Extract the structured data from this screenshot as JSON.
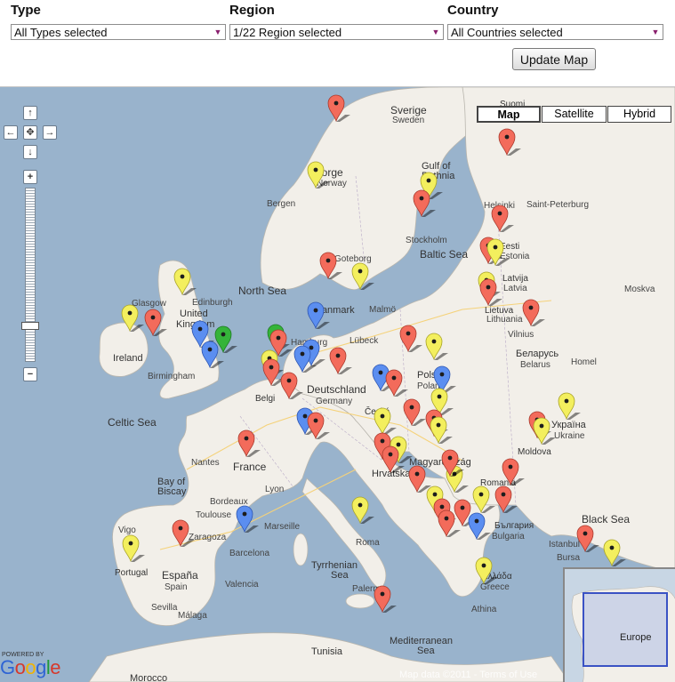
{
  "filters": {
    "type_label": "Type",
    "type_value": "All Types selected",
    "region_label": "Region",
    "region_value": "1/22 Region selected",
    "country_label": "Country",
    "country_value": "All Countries selected",
    "update_label": "Update Map"
  },
  "map": {
    "types": [
      "Map",
      "Satellite",
      "Hybrid"
    ],
    "selected_type": "Map",
    "attribution_data": "Map data ©2011",
    "attribution_sep": " - ",
    "attribution_terms": "Terms of Use",
    "powered_by": "POWERED BY",
    "overview_label": "Europe",
    "zoom_in": "+",
    "zoom_out": "−"
  },
  "colors": {
    "red": "#f36b5b",
    "yellow": "#f3ef5e",
    "blue": "#5b8ef0",
    "green": "#35b43a",
    "water": "#99b3cc",
    "land": "#f2efe9"
  },
  "labels": [
    [
      "Sverige",
      439,
      30,
      12,
      "#333"
    ],
    [
      "Sweden",
      441,
      40,
      10,
      "#444"
    ],
    [
      "Suomi",
      562,
      22,
      10,
      "#333"
    ],
    [
      "Norge",
      353,
      100,
      12,
      "#333"
    ],
    [
      "Norway",
      356,
      111,
      10,
      "#444"
    ],
    [
      "Bergen",
      300,
      134,
      10,
      "#444"
    ],
    [
      "Gulf of",
      474,
      92,
      11,
      "#333"
    ],
    [
      "Bothnia",
      474,
      103,
      11,
      "#333"
    ],
    [
      "Helsinki",
      544,
      136,
      10,
      "#444"
    ],
    [
      "Saint-Peterburg",
      592,
      135,
      10,
      "#444"
    ],
    [
      "Stockholm",
      456,
      175,
      10,
      "#444"
    ],
    [
      "Eesti",
      562,
      182,
      10,
      "#333"
    ],
    [
      "Estonia",
      562,
      193,
      10,
      "#444"
    ],
    [
      "Baltic Sea",
      472,
      192,
      12,
      "#333"
    ],
    [
      "Goteborg",
      376,
      196,
      10,
      "#444"
    ],
    [
      "Latvija",
      565,
      218,
      10,
      "#333"
    ],
    [
      "Latvia",
      566,
      229,
      10,
      "#444"
    ],
    [
      "North Sea",
      268,
      233,
      12,
      "#333"
    ],
    [
      "Danmark",
      354,
      254,
      11,
      "#333"
    ],
    [
      "Malmö",
      415,
      253,
      10,
      "#444"
    ],
    [
      "Lietuva",
      545,
      254,
      10,
      "#333"
    ],
    [
      "Lithuania",
      547,
      264,
      10,
      "#444"
    ],
    [
      "Moskva",
      702,
      230,
      10,
      "#444"
    ],
    [
      "Glasgow",
      148,
      246,
      10,
      "#444"
    ],
    [
      "Edinburgh",
      216,
      245,
      10,
      "#444"
    ],
    [
      "United",
      202,
      258,
      11,
      "#333"
    ],
    [
      "Kingdom",
      198,
      270,
      11,
      "#333"
    ],
    [
      "Ireland",
      127,
      308,
      11,
      "#333"
    ],
    [
      "Birmingham",
      166,
      328,
      10,
      "#444"
    ],
    [
      "Hamburg",
      327,
      290,
      10,
      "#444"
    ],
    [
      "Lübeck",
      393,
      288,
      10,
      "#444"
    ],
    [
      "Vilnius",
      571,
      281,
      10,
      "#444"
    ],
    [
      "Беларусь",
      580,
      303,
      11,
      "#333"
    ],
    [
      "Belarus",
      585,
      315,
      10,
      "#444"
    ],
    [
      "Homel",
      642,
      312,
      10,
      "#444"
    ],
    [
      "Polska",
      469,
      327,
      11,
      "#333"
    ],
    [
      "Poland",
      469,
      339,
      10,
      "#444"
    ],
    [
      "Deutschland",
      345,
      344,
      12,
      "#333"
    ],
    [
      "Germany",
      355,
      356,
      10,
      "#444"
    ],
    [
      "Belgi",
      287,
      353,
      10,
      "#333"
    ],
    [
      "Česká",
      410,
      368,
      10,
      "#333"
    ],
    [
      "Celtic Sea",
      121,
      381,
      12,
      "#333"
    ],
    [
      "Україна",
      620,
      383,
      11,
      "#333"
    ],
    [
      "Ukraine",
      623,
      395,
      10,
      "#444"
    ],
    [
      "France",
      262,
      431,
      12,
      "#333"
    ],
    [
      "Moldova",
      582,
      413,
      10,
      "#333"
    ],
    [
      "Magyarország",
      460,
      425,
      11,
      "#333"
    ],
    [
      "Nantes",
      215,
      425,
      10,
      "#444"
    ],
    [
      "Bay of",
      177,
      447,
      11,
      "#333"
    ],
    [
      "Biscay",
      177,
      458,
      11,
      "#333"
    ],
    [
      "Lyon",
      298,
      455,
      10,
      "#444"
    ],
    [
      "Hrvatska",
      418,
      438,
      11,
      "#333"
    ],
    [
      "Romania",
      540,
      448,
      10,
      "#333"
    ],
    [
      "Bordeaux",
      236,
      469,
      10,
      "#444"
    ],
    [
      "Toulouse",
      220,
      484,
      10,
      "#444"
    ],
    [
      "Marseille",
      297,
      497,
      10,
      "#444"
    ],
    [
      "Black Sea",
      654,
      490,
      12,
      "#333"
    ],
    [
      "България",
      556,
      496,
      10,
      "#333"
    ],
    [
      "Bulgaria",
      553,
      508,
      10,
      "#444"
    ],
    [
      "Zaragoza",
      212,
      509,
      10,
      "#444"
    ],
    [
      "Barcelona",
      258,
      527,
      10,
      "#444"
    ],
    [
      "Roma",
      400,
      515,
      10,
      "#444"
    ],
    [
      "Istanbul",
      617,
      517,
      10,
      "#444"
    ],
    [
      "Bursa",
      626,
      532,
      10,
      "#444"
    ],
    [
      "Vigo",
      133,
      501,
      10,
      "#444"
    ],
    [
      "Portugal",
      129,
      549,
      10,
      "#333"
    ],
    [
      "España",
      182,
      553,
      12,
      "#333"
    ],
    [
      "Spain",
      185,
      565,
      10,
      "#444"
    ],
    [
      "Valencia",
      253,
      562,
      10,
      "#444"
    ],
    [
      "Tyrrhenian",
      350,
      541,
      11,
      "#333"
    ],
    [
      "Sea",
      372,
      552,
      11,
      "#333"
    ],
    [
      "Ελλάδα",
      542,
      553,
      10,
      "#333"
    ],
    [
      "Greece",
      540,
      565,
      10,
      "#444"
    ],
    [
      "Sevilla",
      170,
      588,
      10,
      "#444"
    ],
    [
      "Málaga",
      200,
      597,
      10,
      "#444"
    ],
    [
      "Palermo",
      396,
      567,
      10,
      "#444"
    ],
    [
      "Athina",
      530,
      590,
      10,
      "#444"
    ],
    [
      "Mediterranean",
      438,
      626,
      11,
      "#333"
    ],
    [
      "Sea",
      469,
      637,
      11,
      "#333"
    ],
    [
      "Tunisia",
      350,
      638,
      11,
      "#333"
    ],
    [
      "Morocco",
      146,
      668,
      11,
      "#333"
    ]
  ],
  "markers": [
    [
      "red",
      378,
      38
    ],
    [
      "red",
      570,
      76
    ],
    [
      "yellow",
      355,
      113
    ],
    [
      "yellow",
      482,
      125
    ],
    [
      "red",
      474,
      145
    ],
    [
      "red",
      562,
      162
    ],
    [
      "red",
      549,
      198
    ],
    [
      "yellow",
      557,
      200
    ],
    [
      "red",
      369,
      215
    ],
    [
      "yellow",
      405,
      227
    ],
    [
      "yellow",
      205,
      233
    ],
    [
      "yellow",
      547,
      237
    ],
    [
      "red",
      549,
      245
    ],
    [
      "yellow",
      146,
      274
    ],
    [
      "red",
      172,
      279
    ],
    [
      "blue",
      355,
      271
    ],
    [
      "red",
      597,
      268
    ],
    [
      "blue",
      225,
      292
    ],
    [
      "green",
      251,
      298
    ],
    [
      "blue",
      236,
      315
    ],
    [
      "green",
      310,
      296
    ],
    [
      "red",
      313,
      302
    ],
    [
      "red",
      459,
      297
    ],
    [
      "yellow",
      488,
      306
    ],
    [
      "blue",
      350,
      313
    ],
    [
      "blue",
      340,
      320
    ],
    [
      "red",
      380,
      322
    ],
    [
      "yellow",
      303,
      325
    ],
    [
      "red",
      305,
      335
    ],
    [
      "red",
      325,
      350
    ],
    [
      "blue",
      428,
      341
    ],
    [
      "red",
      443,
      347
    ],
    [
      "blue",
      497,
      343
    ],
    [
      "yellow",
      494,
      368
    ],
    [
      "red",
      463,
      380
    ],
    [
      "red",
      488,
      392
    ],
    [
      "yellow",
      637,
      373
    ],
    [
      "red",
      604,
      394
    ],
    [
      "yellow",
      609,
      401
    ],
    [
      "yellow",
      430,
      390
    ],
    [
      "blue",
      343,
      390
    ],
    [
      "red",
      355,
      395
    ],
    [
      "red",
      277,
      415
    ],
    [
      "red",
      430,
      418
    ],
    [
      "yellow",
      448,
      422
    ],
    [
      "red",
      439,
      433
    ],
    [
      "yellow",
      493,
      400
    ],
    [
      "red",
      469,
      455
    ],
    [
      "yellow",
      511,
      455
    ],
    [
      "red",
      506,
      437
    ],
    [
      "red",
      574,
      447
    ],
    [
      "red",
      566,
      478
    ],
    [
      "yellow",
      541,
      478
    ],
    [
      "yellow",
      489,
      478
    ],
    [
      "red",
      497,
      492
    ],
    [
      "blue",
      275,
      500
    ],
    [
      "yellow",
      405,
      490
    ],
    [
      "red",
      502,
      505
    ],
    [
      "red",
      520,
      493
    ],
    [
      "blue",
      536,
      508
    ],
    [
      "red",
      203,
      516
    ],
    [
      "yellow",
      147,
      533
    ],
    [
      "red",
      658,
      522
    ],
    [
      "yellow",
      688,
      538
    ],
    [
      "yellow",
      544,
      558
    ],
    [
      "red",
      430,
      590
    ]
  ]
}
